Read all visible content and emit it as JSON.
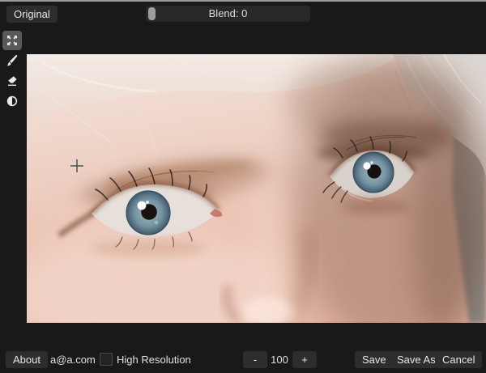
{
  "top_bar": {
    "original_button": "Original",
    "blend": {
      "label": "Blend: 0",
      "value": 0
    }
  },
  "toolbar": {
    "tools": [
      {
        "id": "pan",
        "icon": "expand-arrows-icon",
        "active": true
      },
      {
        "id": "brush",
        "icon": "brush-icon",
        "active": false
      },
      {
        "id": "eraser",
        "icon": "eraser-icon",
        "active": false
      },
      {
        "id": "contrast",
        "icon": "contrast-drop-icon",
        "active": false
      }
    ]
  },
  "canvas": {
    "description": "Close-up photo of a pale-skinned person with wispy white-blond hair and blue-grey eyes; the right side of the face is in shadow against a grey background; a small crosshair cursor sits left of the near eyebrow"
  },
  "bottom_bar": {
    "about_button": "About",
    "email_label": "a@a.com",
    "high_resolution": {
      "label": "High Resolution",
      "checked": false
    },
    "stepper": {
      "decrease": "-",
      "value": "100",
      "increase": "+"
    },
    "save_button": "Save",
    "save_as_button": "Save As",
    "cancel_button": "Cancel"
  },
  "colors": {
    "background": "#191919",
    "control_bg": "#2d2d2d",
    "control_text": "#e6e6e6",
    "slider_track": "#282828",
    "slider_handle": "#9d9d9d",
    "active_tool_bg": "#595959",
    "iris_blue": "#7693a3",
    "skin_light": "#f4e5df",
    "skin_mid": "#e9bbaa",
    "shadow_brown": "#6b4636",
    "background_grey": "#9b9693"
  }
}
